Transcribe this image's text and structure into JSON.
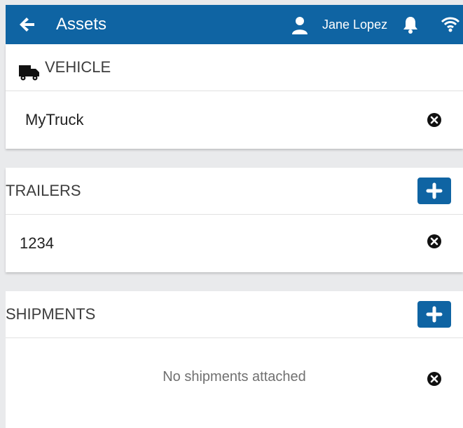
{
  "header": {
    "title": "Assets",
    "user_name": "Jane Lopez",
    "back_icon": "arrow-left-icon",
    "user_icon": "user-icon",
    "bell_icon": "bell-icon",
    "wifi_icon": "wifi-icon",
    "bg_color": "#0f64a3"
  },
  "vehicle": {
    "heading": "VEHICLE",
    "icon": "truck-icon",
    "items": [
      {
        "value": "MyTruck"
      }
    ]
  },
  "trailers": {
    "heading": "TRAILERS",
    "items": [
      {
        "value": "1234"
      }
    ]
  },
  "shipments": {
    "heading": "SHIPMENTS",
    "empty_text": "No shipments attached",
    "items": []
  },
  "colors": {
    "accent": "#0f64a3",
    "page_bg": "#e9eaec"
  }
}
